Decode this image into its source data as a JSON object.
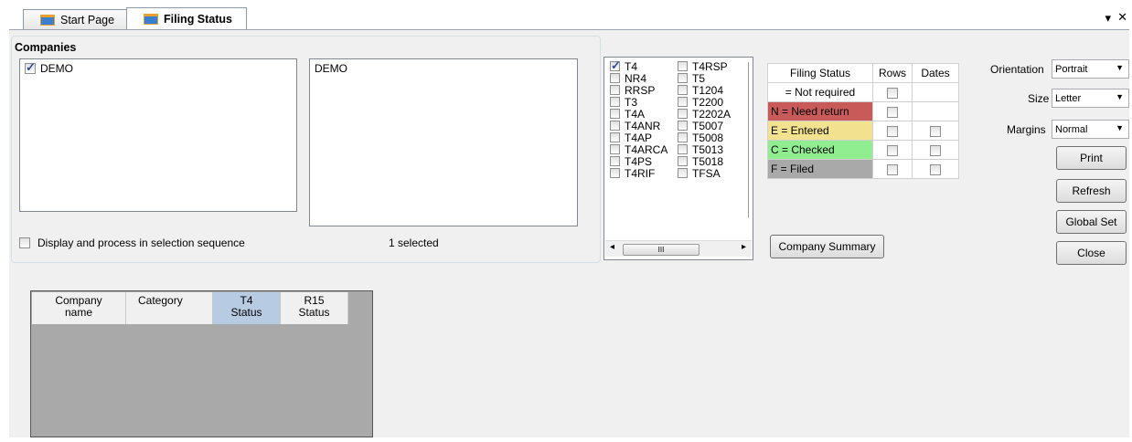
{
  "tabs": [
    {
      "label": "Start Page"
    },
    {
      "label": "Filing Status"
    }
  ],
  "window_controls": {
    "dropdown": "▾",
    "close": "✕"
  },
  "companies": {
    "title": "Companies",
    "left_list": [
      {
        "label": "DEMO",
        "checked": true
      }
    ],
    "right_list": [
      "DEMO"
    ],
    "sequence_label": "Display and process in selection sequence",
    "selected_count": "1 selected"
  },
  "slip_types": {
    "col1": [
      "T4",
      "NR4",
      "RRSP",
      "T3",
      "T4A",
      "T4ANR",
      "T4AP",
      "T4ARCA",
      "T4PS",
      "T4RIF"
    ],
    "col2": [
      "T4RSP",
      "T5",
      "T1204",
      "T2200",
      "T2202A",
      "T5007",
      "T5008",
      "T5013",
      "T5018",
      "TFSA"
    ],
    "checked": [
      "T4"
    ],
    "scroll_grip": "III"
  },
  "legend": {
    "headers": [
      "Filing Status",
      "Rows",
      "Dates"
    ],
    "rows": [
      {
        "label": "= Not required",
        "color": "#ffffff",
        "dates": false
      },
      {
        "label": "N = Need return",
        "color": "#c85a5a",
        "dates": false
      },
      {
        "label": "E = Entered",
        "color": "#f2e18e",
        "dates": true
      },
      {
        "label": "C = Checked",
        "color": "#90ee90",
        "dates": true
      },
      {
        "label": "F = Filed",
        "color": "#a9a9a9",
        "dates": true
      }
    ]
  },
  "company_summary_button": "Company Summary",
  "print_options": {
    "orientation_label": "Orientation",
    "orientation_value": "Portrait",
    "size_label": "Size",
    "size_value": "Letter",
    "margins_label": "Margins",
    "margins_value": "Normal"
  },
  "buttons": {
    "print": "Print",
    "refresh": "Refresh",
    "global_set": "Global Set",
    "close": "Close"
  },
  "grid": {
    "columns": [
      {
        "line1": "Company",
        "line2": "name"
      },
      {
        "line1": "Category",
        "line2": ""
      },
      {
        "line1": "T4",
        "line2": "Status"
      },
      {
        "line1": "R15",
        "line2": "Status"
      }
    ]
  }
}
